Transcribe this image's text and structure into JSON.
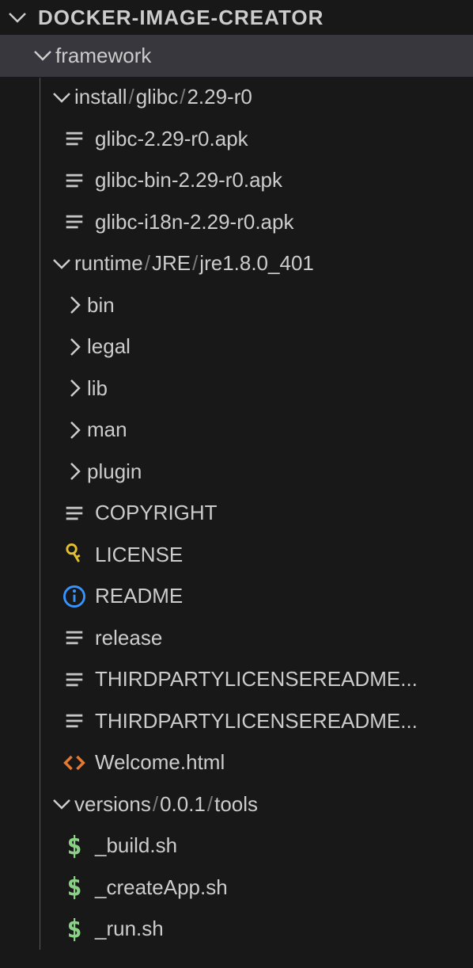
{
  "root": "DOCKER-IMAGE-CREATOR",
  "framework": "framework",
  "install": {
    "seg1": "install",
    "seg2": "glibc",
    "seg3": "2.29-r0"
  },
  "files_install": {
    "f1": "glibc-2.29-r0.apk",
    "f2": "glibc-bin-2.29-r0.apk",
    "f3": "glibc-i18n-2.29-r0.apk"
  },
  "runtime": {
    "seg1": "runtime",
    "seg2": "JRE",
    "seg3": "jre1.8.0_401"
  },
  "dirs_runtime": {
    "d1": "bin",
    "d2": "legal",
    "d3": "lib",
    "d4": "man",
    "d5": "plugin"
  },
  "files_runtime": {
    "f1": "COPYRIGHT",
    "f2": "LICENSE",
    "f3": "README",
    "f4": "release",
    "f5": "THIRDPARTYLICENSEREADME...",
    "f6": "THIRDPARTYLICENSEREADME...",
    "f7": "Welcome.html"
  },
  "versions": {
    "seg1": "versions",
    "seg2": "0.0.1",
    "seg3": "tools"
  },
  "files_versions": {
    "f1": "_build.sh",
    "f2": "_createApp.sh",
    "f3": "_run.sh"
  }
}
